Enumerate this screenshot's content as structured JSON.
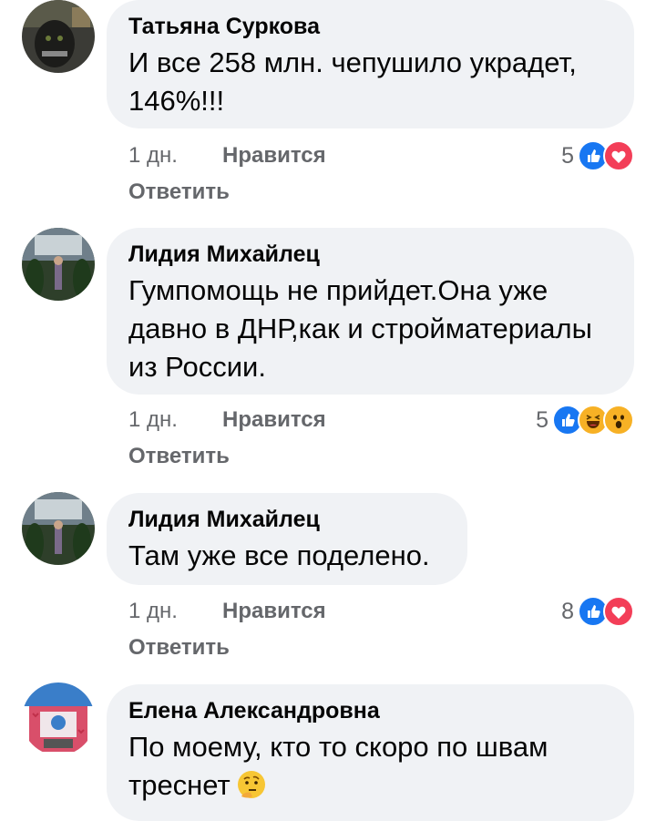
{
  "comments": [
    {
      "author": "Татьяна Суркова",
      "lines": [
        "И все 258 млн. чепушило украдет,",
        "146%!!!"
      ],
      "time": "1 дн.",
      "like_label": "Нравится",
      "reply_label": "Ответить",
      "reaction_count": "5",
      "reactions": [
        "like-icon",
        "love-icon"
      ]
    },
    {
      "author": "Лидия Михайлец",
      "lines": [
        "Гумпомощь не прийдет.Она уже",
        "давно в ДНР,как и стройматериалы",
        "из России."
      ],
      "time": "1 дн.",
      "like_label": "Нравится",
      "reply_label": "Ответить",
      "reaction_count": "5",
      "reactions": [
        "like-icon",
        "haha-icon",
        "wow-icon"
      ]
    },
    {
      "author": "Лидия Михайлец",
      "lines": [
        "Там уже все поделено."
      ],
      "time": "1 дн.",
      "like_label": "Нравится",
      "reply_label": "Ответить",
      "reaction_count": "8",
      "reactions": [
        "like-icon",
        "love-icon"
      ]
    },
    {
      "author": "Елена Александровна",
      "lines": [
        "По моему, кто то скоро по швам",
        "треснет"
      ],
      "trailing_emoji": "thinking-face-icon"
    }
  ],
  "colors": {
    "bubble": "#f0f2f5",
    "secondary_text": "#65676b",
    "like_blue": "#1877f2",
    "love_red": "#f33e58",
    "haha_yellow": "#f7b125"
  }
}
